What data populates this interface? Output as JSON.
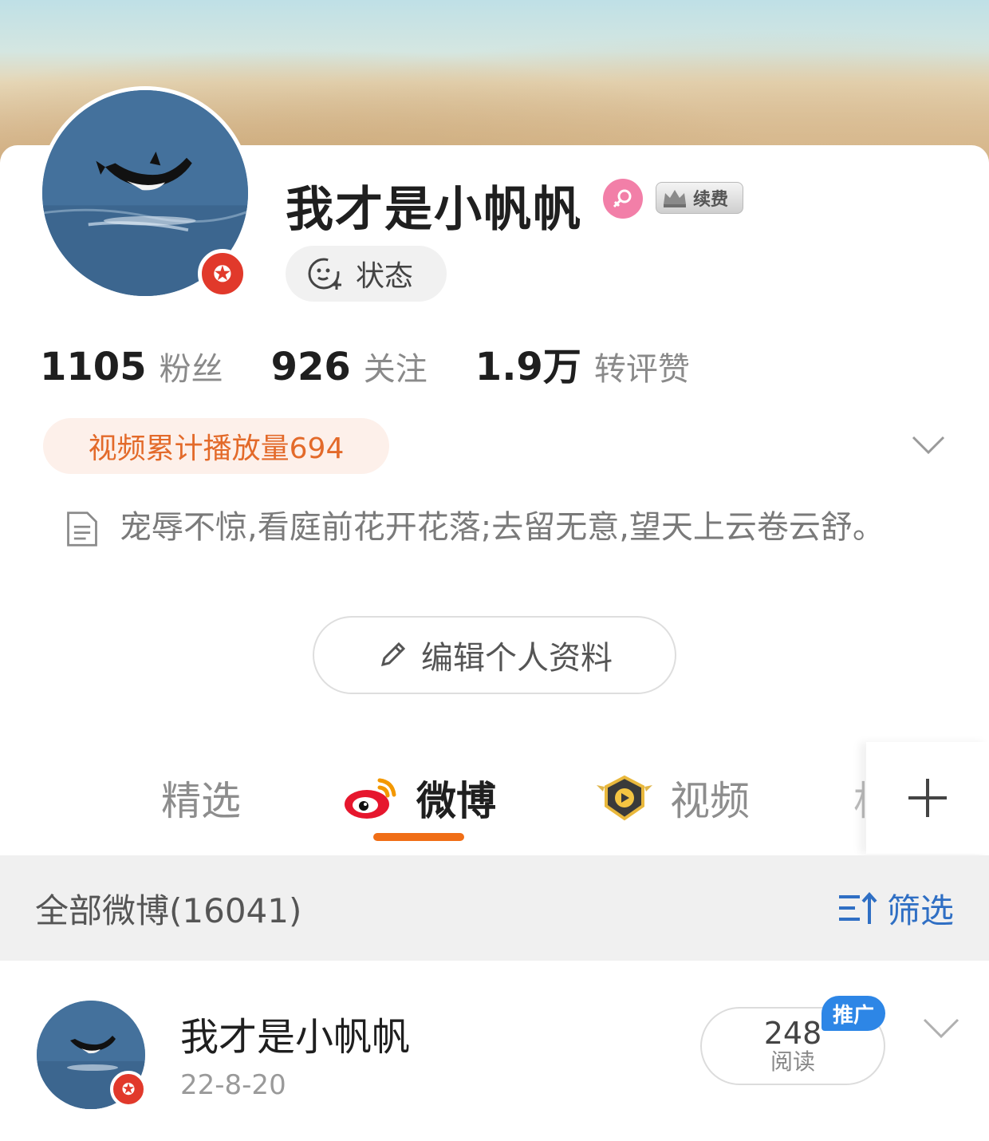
{
  "profile": {
    "name": "我才是小帆帆",
    "vip_label": "续费",
    "status_label": "状态",
    "stats": [
      {
        "value": "1105",
        "label": "粉丝"
      },
      {
        "value": "926",
        "label": "关注"
      },
      {
        "value": "1.9万",
        "label": "转评赞"
      }
    ],
    "video_plays": "视频累计播放量694",
    "bio": "宠辱不惊,看庭前花开花落;去留无意,望天上云卷云舒。",
    "edit_label": "编辑个人资料"
  },
  "tabs": [
    {
      "label": "精选"
    },
    {
      "label": "微博"
    },
    {
      "label": "视频"
    },
    {
      "label": "相"
    }
  ],
  "feed": {
    "all_label": "全部微博(16041)",
    "filter_label": "筛选"
  },
  "post": {
    "author": "我才是小帆帆",
    "date": "22-8-20",
    "read_count": "248",
    "read_unit": "阅读",
    "promo_label": "推广"
  },
  "colors": {
    "accent": "#f06e16",
    "link": "#2f6fc4",
    "badge_red": "#e1392b",
    "promo_blue": "#2d86e6"
  },
  "icons": [
    "status-face-icon",
    "gender-female-icon",
    "vip-crown-icon",
    "chevron-down-icon",
    "document-icon",
    "pencil-icon",
    "weibo-logo-icon",
    "video-badge-icon",
    "plus-icon",
    "sort-filter-icon",
    "verified-star-icon"
  ]
}
